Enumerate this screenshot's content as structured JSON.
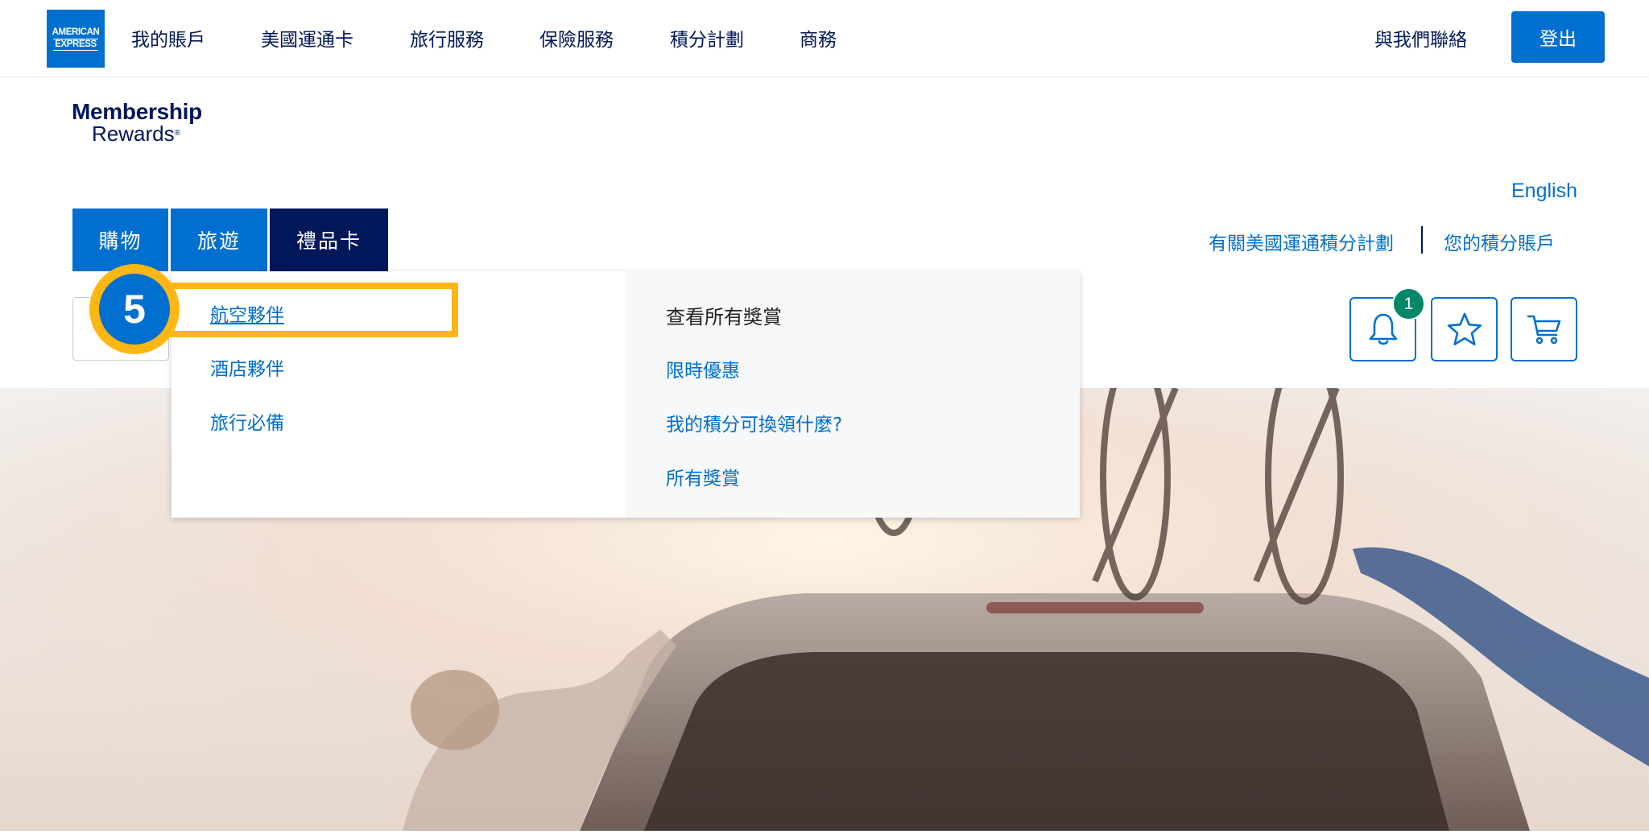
{
  "brand": {
    "logo_line1": "AMERICAN",
    "logo_line2": "EXPRESS",
    "primary_color": "#006fcf",
    "dark_color": "#00175a",
    "highlight_color": "#fdb714"
  },
  "topnav": {
    "items": [
      "我的賬戶",
      "美國運通卡",
      "旅行服務",
      "保險服務",
      "積分計劃",
      "商務"
    ],
    "contact": "與我們聯絡",
    "logout": "登出"
  },
  "membership_logo": {
    "line1": "Membership",
    "line2": "Rewards",
    "reg": "®"
  },
  "utility": {
    "language": "English",
    "about_link": "有關美國運通積分計劃",
    "account_link": "您的積分賬戶"
  },
  "category_tabs": [
    "購物",
    "旅遊",
    "禮品卡"
  ],
  "icons": {
    "notifications": "bell-icon",
    "favorites": "star-icon",
    "cart": "cart-icon",
    "notification_count": "1"
  },
  "dropdown": {
    "left_items": [
      "航空夥伴",
      "酒店夥伴",
      "旅行必備"
    ],
    "right_heading": "查看所有獎賞",
    "right_items": [
      "限時優惠",
      "我的積分可換領什麼?",
      "所有獎賞"
    ]
  },
  "tutorial": {
    "step_number": "5"
  }
}
